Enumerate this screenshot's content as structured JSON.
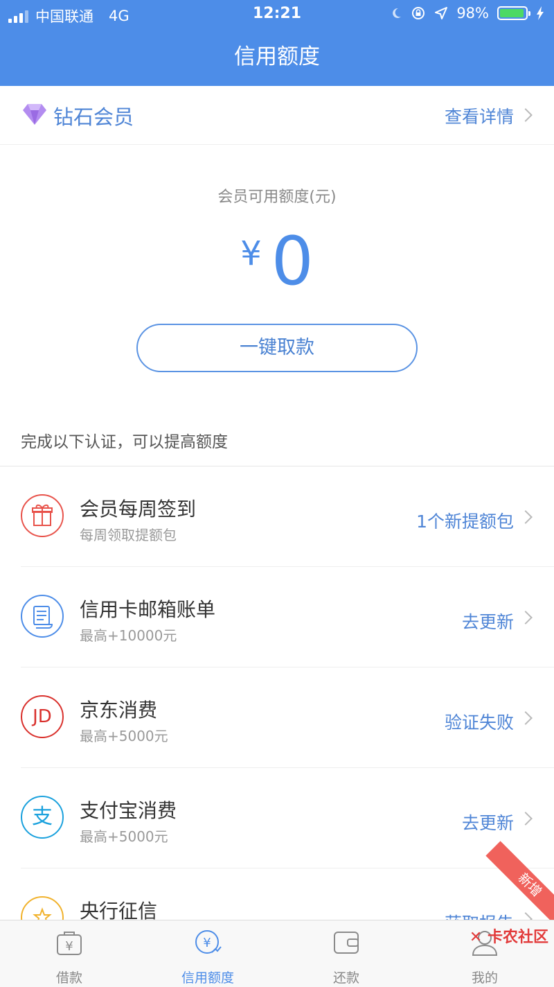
{
  "status_bar": {
    "carrier": "中国联通",
    "network": "4G",
    "time": "12:21",
    "battery": "98%"
  },
  "navbar": {
    "title": "信用额度"
  },
  "member": {
    "label": "钻石会员",
    "detail_link": "查看详情"
  },
  "quota": {
    "label": "会员可用额度(元)",
    "currency_symbol": "¥",
    "amount": "0",
    "withdraw_button": "一键取款"
  },
  "verification": {
    "hint": "完成以下认证，可以提高额度",
    "items": [
      {
        "title": "会员每周签到",
        "subtitle": "每周领取提额包",
        "action": "1个新提额包",
        "icon": "gift-icon",
        "color": "#e8524a"
      },
      {
        "title": "信用卡邮箱账单",
        "subtitle": "最高+10000元",
        "action": "去更新",
        "icon": "bill-icon",
        "color": "#4d8de8"
      },
      {
        "title": "京东消费",
        "subtitle": "最高+5000元",
        "action": "验证失败",
        "icon": "jd-icon",
        "glyph": "JD",
        "color": "#d9302c"
      },
      {
        "title": "支付宝消费",
        "subtitle": "最高+5000元",
        "action": "去更新",
        "icon": "alipay-icon",
        "glyph": "支",
        "color": "#1aa1dd"
      },
      {
        "title": "央行征信",
        "subtitle": "",
        "action": "获取报告",
        "icon": "star-badge-icon",
        "color": "#f1b22c",
        "badge": "新增"
      }
    ]
  },
  "tabbar": {
    "tabs": [
      {
        "label": "借款",
        "icon": "loan-bag-icon",
        "active": false
      },
      {
        "label": "信用额度",
        "icon": "credit-limit-icon",
        "active": true
      },
      {
        "label": "还款",
        "icon": "wallet-icon",
        "active": false
      },
      {
        "label": "我的",
        "icon": "user-icon",
        "active": false
      }
    ]
  },
  "watermark": "卡农社区",
  "colors": {
    "primary": "#4d8de8",
    "link": "#4f85d6",
    "badge": "#f0625c"
  }
}
